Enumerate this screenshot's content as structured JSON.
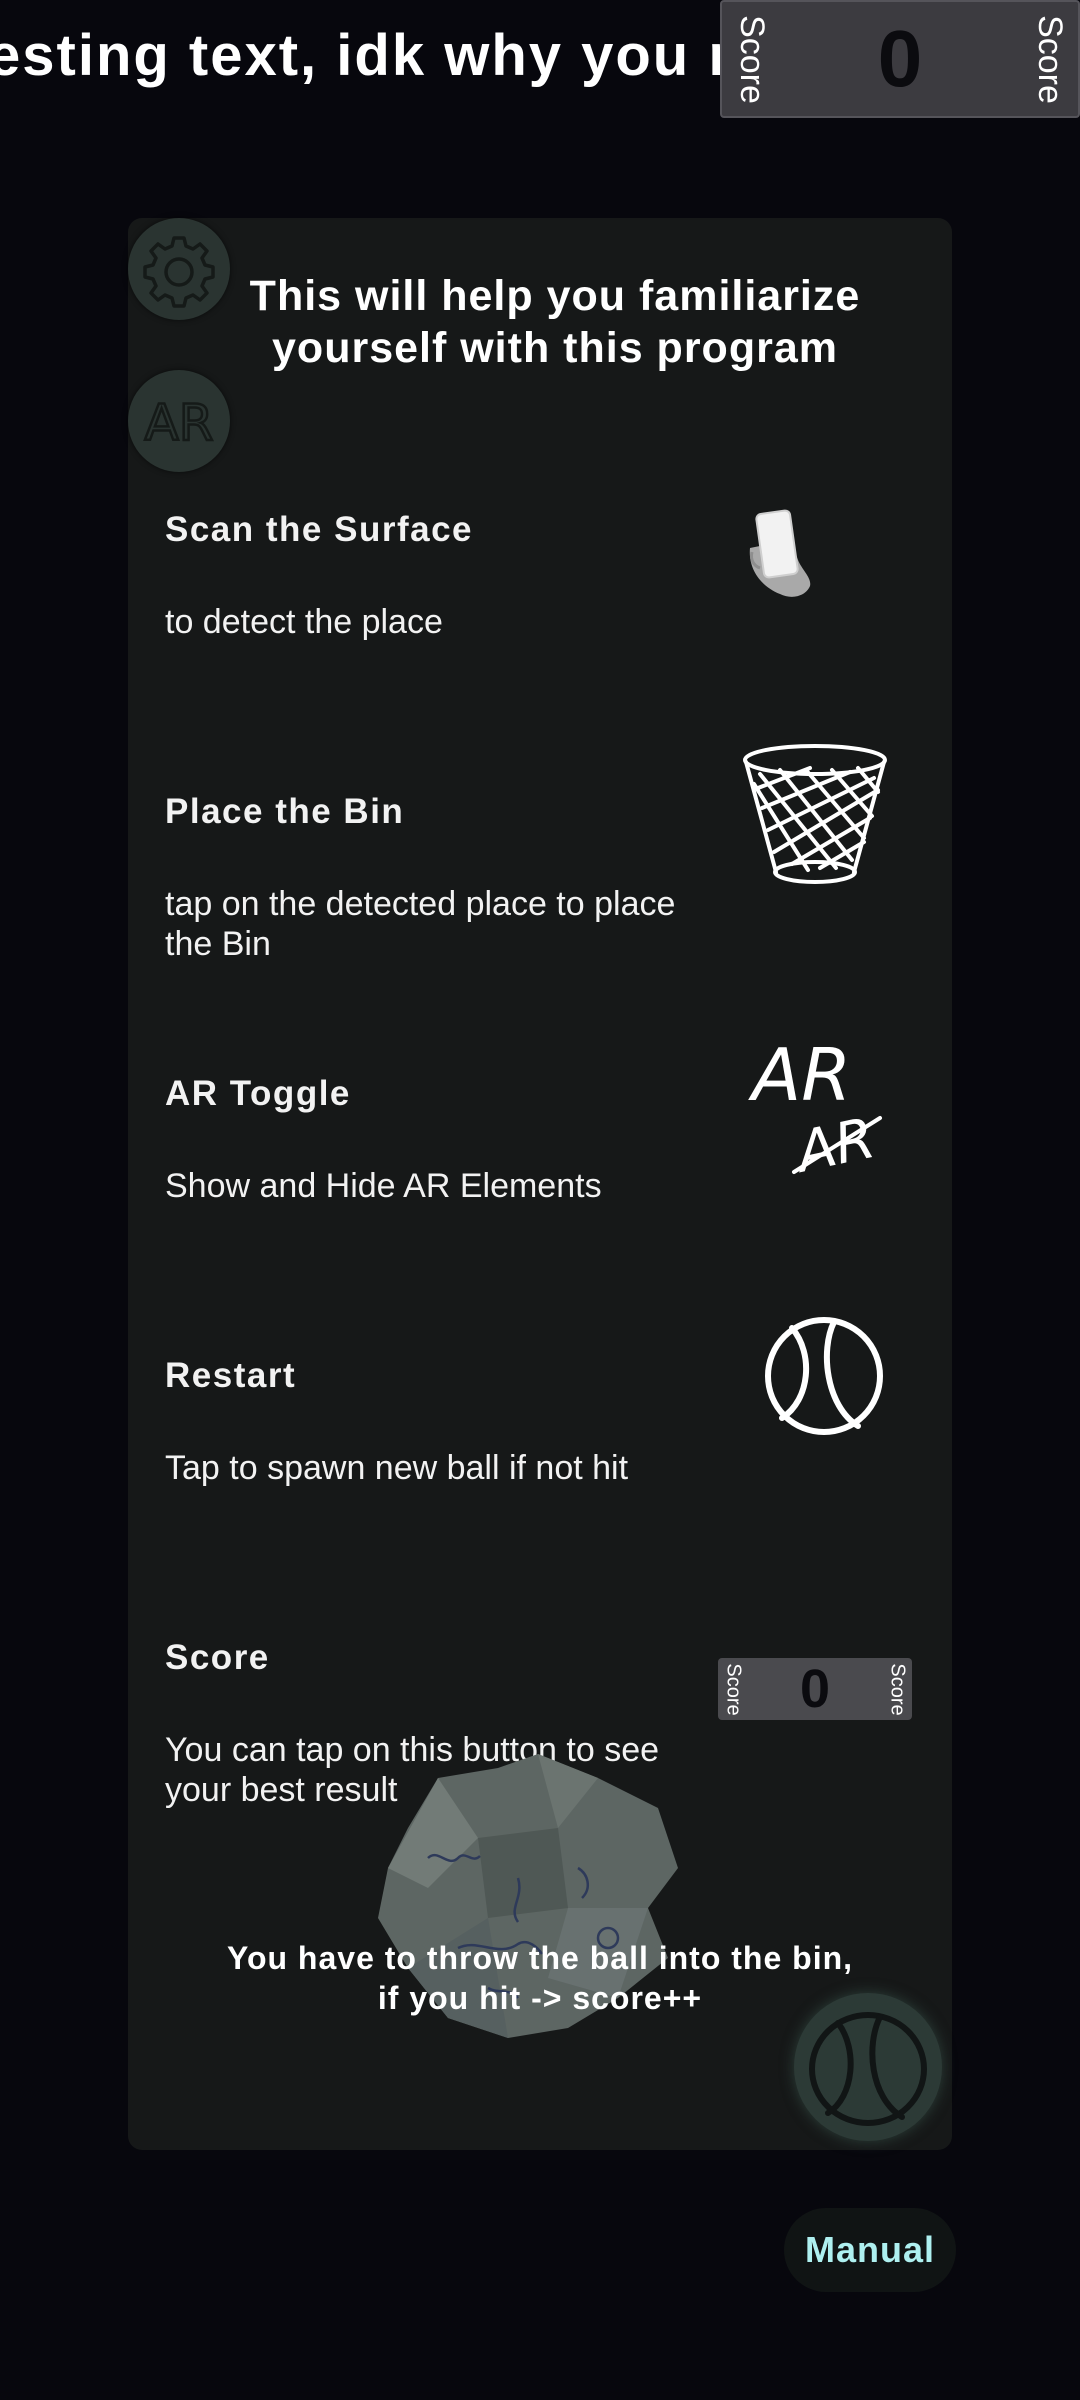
{
  "header": {
    "marquee_text": "esting text, idk why you r",
    "score": {
      "left_label": "Score",
      "value": "0",
      "right_label": "Score"
    }
  },
  "panel": {
    "title": "This will help you familiarize yourself with this program",
    "settings_icon": "gear-icon",
    "ar_button_label": "AR",
    "steps": [
      {
        "title": "Scan the Surface",
        "description": "to detect the place",
        "icon": "hand-phone-icon"
      },
      {
        "title": "Place the Bin",
        "description": "tap on the detected place to place the Bin",
        "icon": "waste-bin-icon"
      },
      {
        "title": "AR Toggle",
        "description": "Show and Hide AR Elements",
        "icon": "ar-toggle-icon",
        "icon_text_top": "AR",
        "icon_text_bottom": "AR"
      },
      {
        "title": "Restart",
        "description": "Tap to spawn new ball if not hit",
        "icon": "ball-icon"
      },
      {
        "title": "Score",
        "description": "You can tap on this button to see your best result",
        "icon": "score-widget"
      }
    ],
    "mini_score": {
      "left_label": "Score",
      "value": "0",
      "right_label": "Score"
    },
    "bottom_note_line1": "You have to throw the ball into the bin,",
    "bottom_note_line2": "if you hit -> score++"
  },
  "manual_button": {
    "label": "Manual"
  },
  "colors": {
    "background": "#07070d",
    "panel": "#161818",
    "accent_manual": "#aef0f0",
    "score_bg": "#3c3b40"
  }
}
